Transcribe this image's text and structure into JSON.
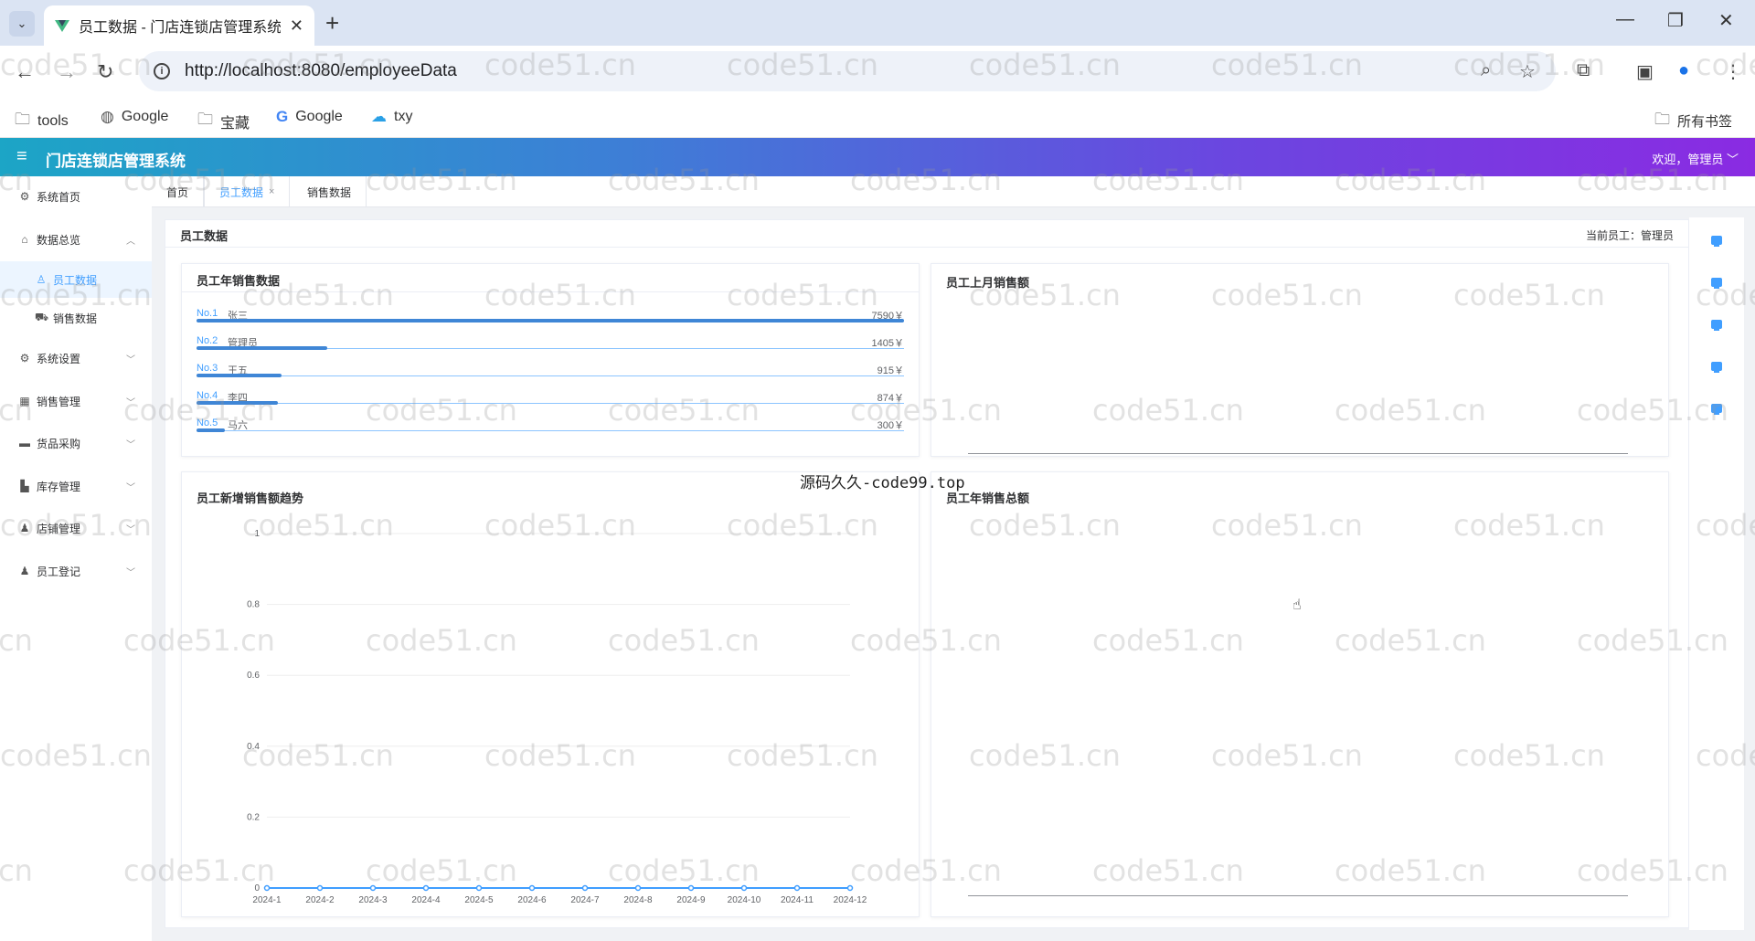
{
  "browser": {
    "tab_title": "员工数据 - 门店连锁店管理系统",
    "url": "http://localhost:8080/employeeData",
    "bookmarks": [
      {
        "label": "tools",
        "icon": "folder-icon"
      },
      {
        "label": "Google",
        "icon": "globe-icon"
      },
      {
        "label": "宝藏",
        "icon": "folder-icon"
      },
      {
        "label": "Google",
        "icon": "google-icon"
      },
      {
        "label": "txy",
        "icon": "cloud-icon"
      }
    ],
    "all_bookmarks": "所有书签"
  },
  "app": {
    "title": "门店连锁店管理系统",
    "welcome": "欢迎，管理员 ﹀"
  },
  "sidebar": {
    "items": [
      {
        "label": "系统首页",
        "icon": "gear-icon"
      },
      {
        "label": "数据总览",
        "icon": "home-icon",
        "expanded": true
      },
      {
        "label": "员工数据",
        "icon": "user-icon",
        "active": true
      },
      {
        "label": "销售数据",
        "icon": "truck-icon"
      },
      {
        "label": "系统设置",
        "icon": "gear-icon"
      },
      {
        "label": "销售管理",
        "icon": "chart-icon"
      },
      {
        "label": "货品采购",
        "icon": "lock-icon"
      },
      {
        "label": "库存管理",
        "icon": "warehouse-icon"
      },
      {
        "label": "店铺管理",
        "icon": "user-icon"
      },
      {
        "label": "员工登记",
        "icon": "user-icon"
      }
    ]
  },
  "page_tabs": [
    {
      "label": "首页"
    },
    {
      "label": "员工数据",
      "active": true,
      "close": "×"
    },
    {
      "label": "销售数据"
    }
  ],
  "main": {
    "title": "员工数据",
    "current_employee": "当前员工：管理员"
  },
  "ranking": {
    "title": "员工年销售数据",
    "rows": [
      {
        "no": "No.1",
        "name": "张三",
        "amount": "7590￥",
        "value": 7590
      },
      {
        "no": "No.2",
        "name": "管理员",
        "amount": "1405￥",
        "value": 1405
      },
      {
        "no": "No.3",
        "name": "王五",
        "amount": "915￥",
        "value": 915
      },
      {
        "no": "No.4",
        "name": "李四",
        "amount": "874￥",
        "value": 874
      },
      {
        "no": "No.5",
        "name": "马六",
        "amount": "300￥",
        "value": 300
      }
    ]
  },
  "last_month_card": {
    "title": "员工上月销售额"
  },
  "annual_total_card": {
    "title": "员工年销售总额"
  },
  "overlay_text": "源码久久-code99.top",
  "watermark_text": "code51.cn",
  "chart_data": {
    "type": "line",
    "title": "员工新增销售额趋势",
    "categories": [
      "2024-1",
      "2024-2",
      "2024-3",
      "2024-4",
      "2024-5",
      "2024-6",
      "2024-7",
      "2024-8",
      "2024-9",
      "2024-10",
      "2024-11",
      "2024-12"
    ],
    "series": [
      {
        "values": [
          0,
          0,
          0,
          0,
          0,
          0,
          0,
          0,
          0,
          0,
          0,
          0
        ]
      }
    ],
    "ylim": [
      0,
      1
    ],
    "yticks": [
      "0",
      "0.2",
      "0.4",
      "0.6",
      "0.8",
      "1"
    ],
    "grid": true,
    "color": "#409eff"
  }
}
